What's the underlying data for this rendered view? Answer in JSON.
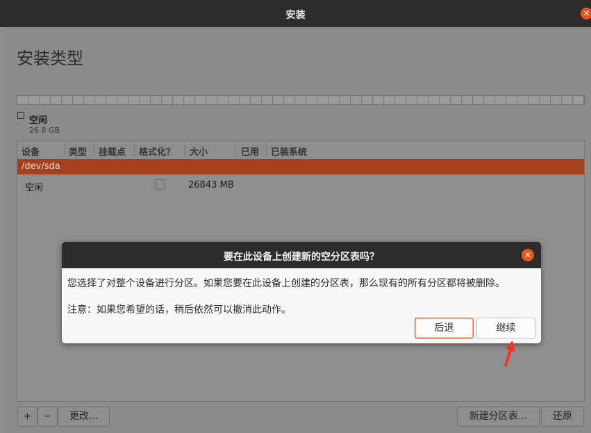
{
  "window": {
    "title": "安装",
    "close_glyph": "✕"
  },
  "page": {
    "title": "安装类型"
  },
  "partition_bar": {
    "free_label": "空闲",
    "free_size": "26.8 GB"
  },
  "table": {
    "headers": [
      "设备",
      "类型",
      "挂载点",
      "格式化？",
      "大小",
      "已用",
      "已装系统"
    ],
    "device_row": "/dev/sda",
    "free_row": {
      "device": "空闲",
      "size": "26843 MB"
    }
  },
  "toolbar": {
    "add": "+",
    "remove": "−",
    "change": "更改...",
    "new_table": "新建分区表...",
    "revert": "还原"
  },
  "dialog": {
    "title": "要在此设备上创建新的空分区表吗？",
    "message": "您选择了对整个设备进行分区。如果您要在此设备上创建的分区表，那么现有的所有分区都将被删除。",
    "note": "注意：如果您希望的话，稍后依然可以撤消此动作。",
    "back_label": "后退",
    "continue_label": "继续",
    "close_glyph": "✕"
  },
  "colors": {
    "accent": "#e95420",
    "selected_row": "#a4401c",
    "annotation": "#ee3524"
  }
}
